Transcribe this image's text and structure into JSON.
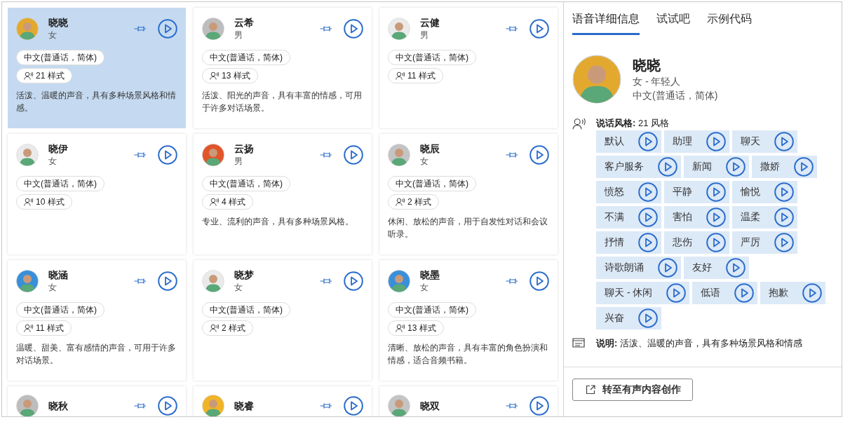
{
  "cards": [
    {
      "name": "晓晓",
      "gender": "女",
      "language": "中文(普通话，简体)",
      "styles": "21 样式",
      "description": "活泼、温暖的声音，具有多种场景风格和情感。",
      "selected": true,
      "color": "#e3a92f"
    },
    {
      "name": "云希",
      "gender": "男",
      "language": "中文(普通话，简体)",
      "styles": "13 样式",
      "description": "活泼、阳光的声音，具有丰富的情感，可用于许多对话场景。",
      "selected": false,
      "color": "#bdbdbd"
    },
    {
      "name": "云健",
      "gender": "男",
      "language": "中文(普通话，简体)",
      "styles": "11 样式",
      "selected": false,
      "color": "#eaeaea"
    },
    {
      "name": "晓伊",
      "gender": "女",
      "language": "中文(普通话，简体)",
      "styles": "10 样式",
      "selected": false,
      "color": "#eaeaea"
    },
    {
      "name": "云扬",
      "gender": "男",
      "language": "中文(普通话，简体)",
      "styles": "4 样式",
      "description": "专业、流利的声音，具有多种场景风格。",
      "selected": false,
      "color": "#e0552a"
    },
    {
      "name": "晓辰",
      "gender": "女",
      "language": "中文(普通话，简体)",
      "styles": "2 样式",
      "description": "休闲、放松的声音，用于自发性对话和会议听录。",
      "selected": false,
      "color": "#c4c4c4"
    },
    {
      "name": "晓涵",
      "gender": "女",
      "language": "中文(普通话，简体)",
      "styles": "11 样式",
      "description": "温暖、甜美、富有感情的声音，可用于许多对话场景。",
      "selected": false,
      "color": "#3a8fd9"
    },
    {
      "name": "晓梦",
      "gender": "女",
      "language": "中文(普通话，简体)",
      "styles": "2 样式",
      "selected": false,
      "color": "#eaeaea"
    },
    {
      "name": "晓墨",
      "gender": "女",
      "language": "中文(普通话，简体)",
      "styles": "13 样式",
      "description": "清晰、放松的声音，具有丰富的角色扮演和情感，适合音频书籍。",
      "selected": false,
      "color": "#3a8fd9"
    },
    {
      "name": "晓秋",
      "selected": false,
      "color": "#bdbdbd"
    },
    {
      "name": "晓睿",
      "selected": false,
      "color": "#f0b429"
    },
    {
      "name": "晓双",
      "selected": false,
      "color": "#c4c4c4"
    }
  ],
  "detail_panel": {
    "tabs": [
      {
        "label": "语音详细信息",
        "selected": true
      },
      {
        "label": "试试吧",
        "selected": false
      },
      {
        "label": "示例代码",
        "selected": false
      }
    ],
    "name": "晓晓",
    "gender_age": "女 - 年轻人",
    "language": "中文(普通话，简体)",
    "color": "#e3a92f",
    "styles_heading": "**说话风格:** 21 风格",
    "styles": [
      "默认",
      "助理",
      "聊天",
      "客户服务",
      "新闻",
      "撒娇",
      "愤怒",
      "平静",
      "愉悦",
      "不满",
      "害怕",
      "温柔",
      "抒情",
      "悲伤",
      "严厉",
      "诗歌朗诵",
      "友好",
      "聊天 - 休闲",
      "低语",
      "抱歉",
      "兴奋"
    ],
    "description": "**说明:** 活泼、温暖的声音，具有多种场景风格和情感",
    "button": "转至有声内容创作"
  }
}
